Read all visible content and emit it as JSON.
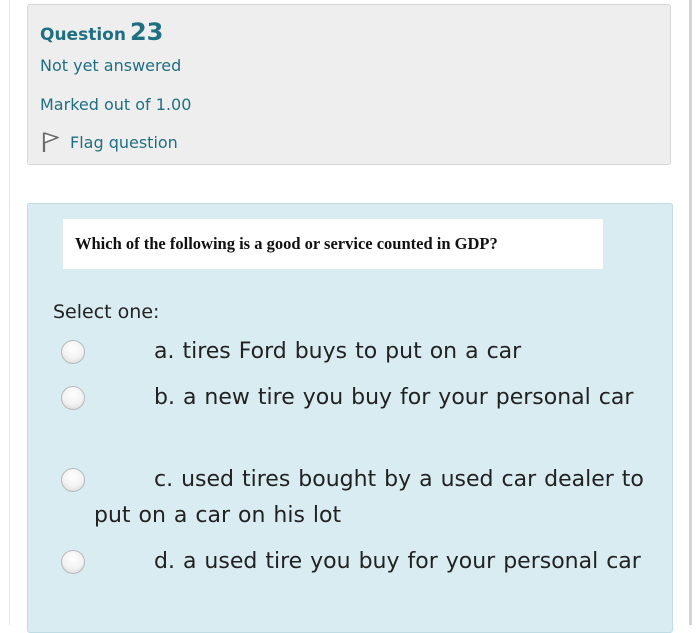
{
  "question_info": {
    "label": "Question",
    "number": "23",
    "state": "Not yet answered",
    "grade": "Marked out of 1.00",
    "flag_label": "Flag question"
  },
  "formulation": {
    "question_text": "Which of the following is a good or service counted in GDP?",
    "prompt": "Select one:",
    "options": [
      {
        "text": "a. tires Ford buys to put on a car"
      },
      {
        "text": "b. a new tire you buy for your personal car"
      },
      {
        "text": "c. used tires bought by a used car dealer to put on a car on his lot"
      },
      {
        "text": "d.  a used tire you buy for your personal car"
      }
    ]
  },
  "colors": {
    "info_background": "#eeeeee",
    "formulation_background": "#d9ecf2",
    "accent_text": "#1f6f80"
  },
  "icons": {
    "flag": "flag-icon",
    "radio": "radio-unchecked-icon"
  }
}
